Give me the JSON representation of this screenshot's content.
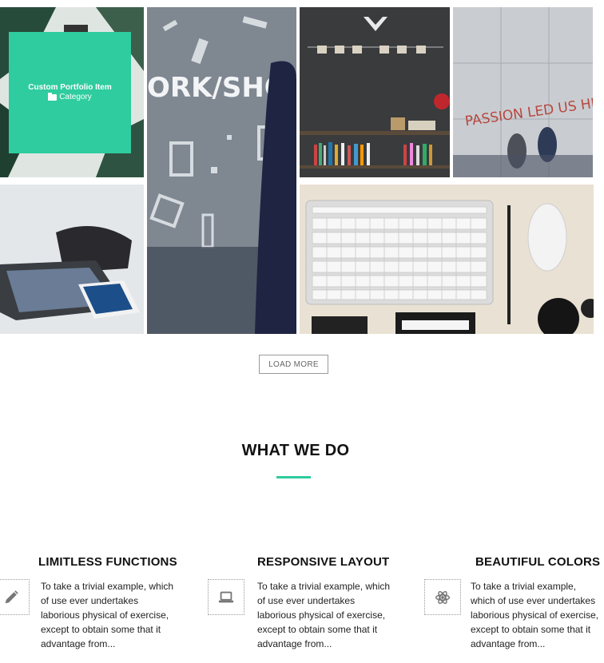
{
  "portfolio": {
    "overlay_title": "Custom Portfolio Item",
    "overlay_category": "Category",
    "load_more_label": "LOAD MORE",
    "images": {
      "workshop_sign_text": "ORK/SHOP",
      "pavement_text": "PASSION LED US HERE"
    }
  },
  "section": {
    "title": "WHAT WE DO"
  },
  "features": [
    {
      "title": "LIMITLESS FUNCTIONS",
      "text": "To take a trivial example, which of use ever undertakes laborious physical of exercise, except to obtain some that it advantage from...",
      "icon": "pencil-icon"
    },
    {
      "title": "RESPONSIVE LAYOUT",
      "text": "To take a trivial example, which of use ever undertakes laborious physical of exercise, except to obtain some that it advantage from...",
      "icon": "laptop-icon"
    },
    {
      "title": "BEAUTIFUL COLORS",
      "text": "To take a trivial example, which of use ever undertakes laborious physical of exercise, except to obtain some that it advantage from...",
      "icon": "atom-icon"
    }
  ],
  "colors": {
    "accent": "#2ecc9e"
  }
}
